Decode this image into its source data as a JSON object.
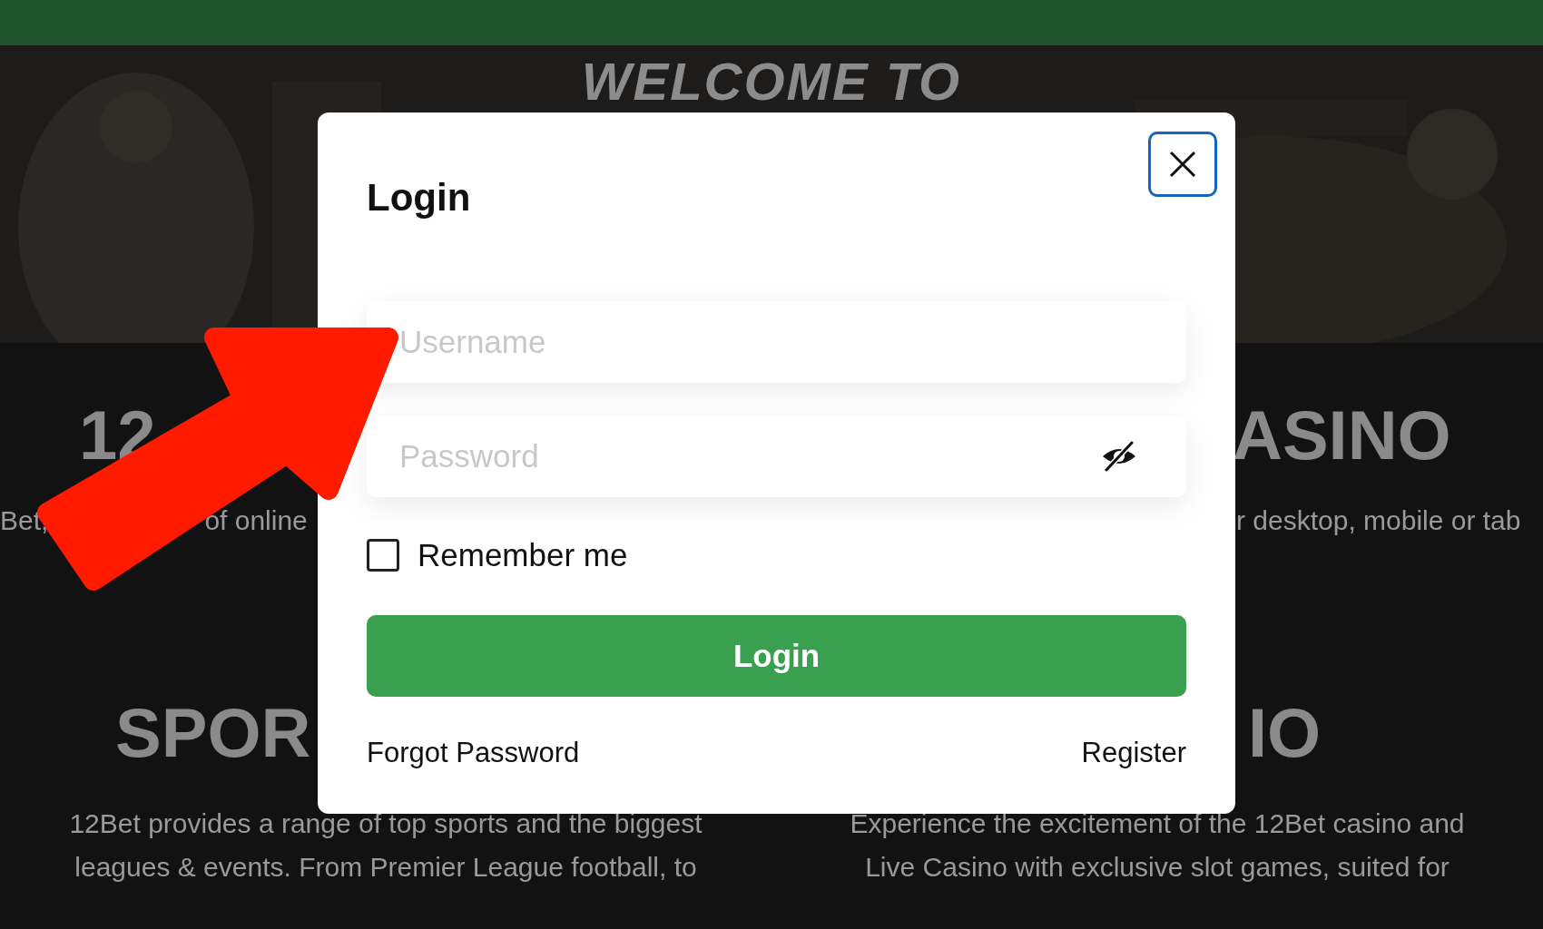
{
  "hero": {
    "kind": "picture",
    "title": "WELCOME TO"
  },
  "sections": [
    {
      "heading": "12",
      "lines": [
        [
          "Bet,",
          "of online"
        ]
      ]
    },
    {
      "heading": "ASINO",
      "lines": [
        [
          "r desktop, mobile or tab"
        ]
      ]
    },
    {
      "heading": "SPOR",
      "lines": [
        [
          "12Bet provides a range of top sports and the biggest"
        ],
        [
          "leagues & events. From Premier League football, to"
        ]
      ]
    },
    {
      "heading": "IO",
      "lines": [
        [
          "Experience the excitement of the 12Bet casino and"
        ],
        [
          "Live Casino with exclusive slot games, suited for"
        ]
      ]
    }
  ],
  "modal": {
    "title": "Login",
    "fields": [
      {
        "kind": "text",
        "placeholder": "Username"
      },
      {
        "kind": "password",
        "placeholder": "Password"
      }
    ],
    "remember": {
      "label": "Remember me",
      "checked": false
    },
    "button": "Login",
    "links": [
      "Forgot Password",
      "Register"
    ]
  },
  "annotation": {
    "kind": "arrow",
    "color": "#ff1a00"
  }
}
